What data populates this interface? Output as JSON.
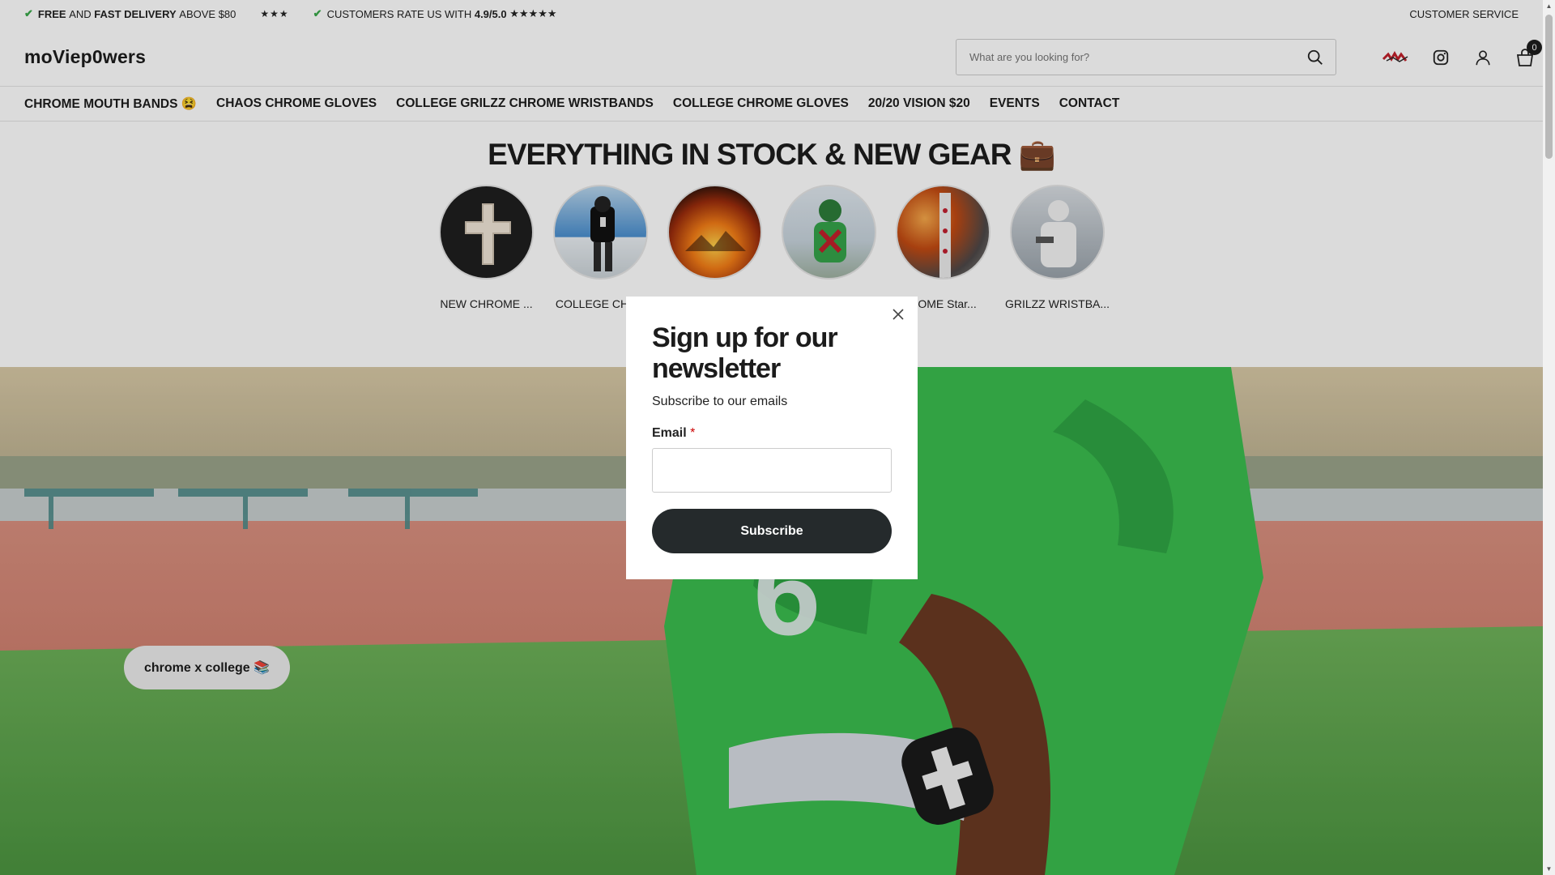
{
  "announcement": {
    "delivery_free": "FREE",
    "delivery_and": "AND",
    "delivery_fast": "FAST DELIVERY",
    "delivery_above": "ABOVE $80",
    "stars_small": "★★★",
    "rating_prefix": "CUSTOMERS RATE US WITH",
    "rating_value": "4.9/5.0",
    "rating_stars": "★★★★★",
    "customer_service": "CUSTOMER SERVICE"
  },
  "header": {
    "logo": "moViep0wers",
    "search_placeholder": "What are you looking for?",
    "cart_count": "0"
  },
  "nav": {
    "items": [
      "CHROME MOUTH BANDS 😫",
      "CHAOS CHROME GLOVES",
      "COLLEGE GRILZZ CHROME WRISTBANDS",
      "COLLEGE CHROME GLOVES",
      "20/20 VISION $20",
      "EVENTS",
      "CONTACT"
    ]
  },
  "collections": {
    "title": "EVERYTHING IN STOCK & NEW GEAR 💼",
    "items": [
      {
        "label": "NEW CHROME ..."
      },
      {
        "label": "COLLEGE CHRO"
      },
      {
        "label": ""
      },
      {
        "label": ""
      },
      {
        "label": "ROME Star..."
      },
      {
        "label": "GRILZZ WRISTBA..."
      }
    ]
  },
  "hero": {
    "pill_label": "chrome x college 📚"
  },
  "modal": {
    "title": "Sign up for our newsletter",
    "subtitle": "Subscribe to our emails",
    "email_label": "Email",
    "required_mark": "*",
    "email_value": "",
    "subscribe_label": "Subscribe"
  },
  "colors": {
    "check": "#3aa84a",
    "button_dark": "#252a2c",
    "hero_green": "#35b94a",
    "track": "#d98c7f"
  },
  "icons": [
    "check-icon",
    "search-icon",
    "brand-logo-icon",
    "instagram-icon",
    "account-icon",
    "cart-icon",
    "close-icon"
  ]
}
